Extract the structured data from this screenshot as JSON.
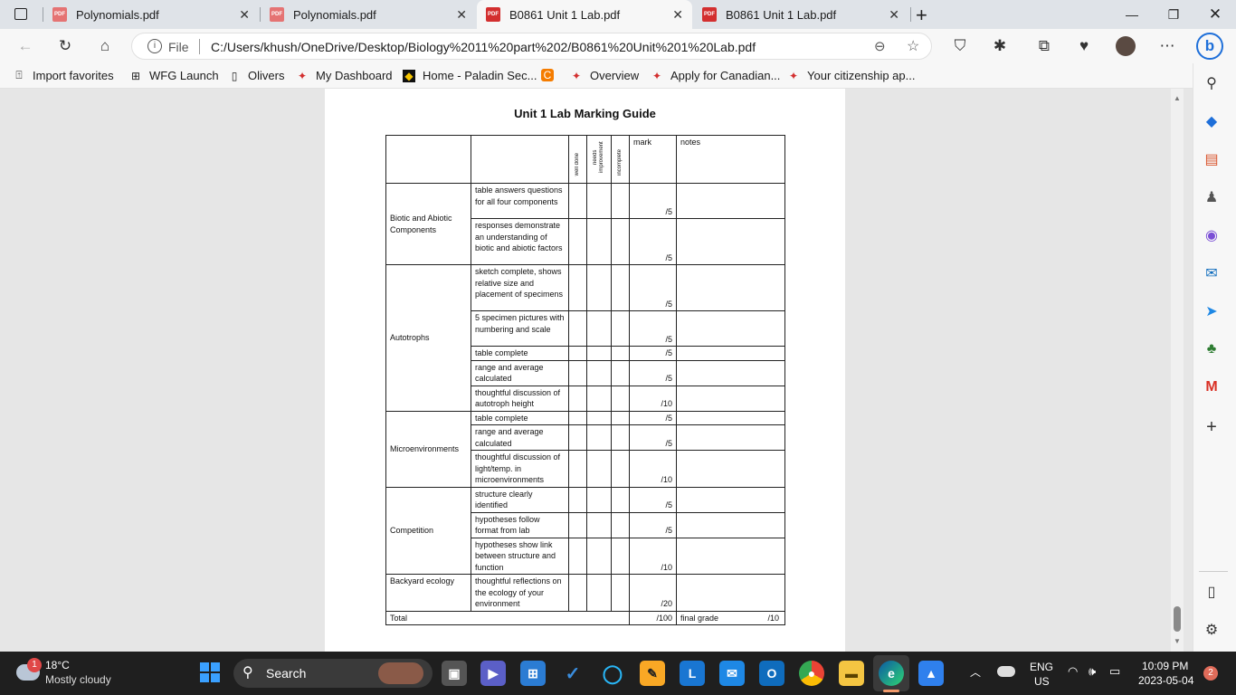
{
  "browser": {
    "tabs": [
      {
        "label": "Polynomials.pdf",
        "active": false
      },
      {
        "label": "Polynomials.pdf",
        "active": false
      },
      {
        "label": "B0861 Unit 1 Lab.pdf",
        "active": true
      },
      {
        "label": "B0861 Unit 1 Lab.pdf",
        "active": false
      }
    ],
    "file_label": "File",
    "url": "C:/Users/khush/OneDrive/Desktop/Biology%2011%20part%202/B0861%20Unit%201%20Lab.pdf",
    "favorites": [
      "Import favorites",
      "WFG Launch",
      "Olivers",
      "My Dashboard",
      "Home - Paladin Sec...",
      "Overview",
      "Apply for Canadian...",
      "Your citizenship ap..."
    ]
  },
  "document": {
    "title": "Unit 1 Lab Marking Guide",
    "header": {
      "well_done": "well done",
      "needs_improvement": "needs improvement",
      "incomplete": "incomplete",
      "mark": "mark",
      "notes": "notes"
    },
    "sections": [
      {
        "name": "Biotic and Abiotic Components",
        "rows": [
          {
            "criterion": "table answers questions for all four components",
            "mark": "/5"
          },
          {
            "criterion": "responses demonstrate an understanding of biotic and abiotic factors",
            "mark": "/5"
          }
        ]
      },
      {
        "name": "Autotrophs",
        "rows": [
          {
            "criterion": "sketch complete, shows relative size and placement of specimens",
            "mark": "/5"
          },
          {
            "criterion": "5 specimen pictures with numbering and scale",
            "mark": "/5"
          },
          {
            "criterion": "table complete",
            "mark": "/5"
          },
          {
            "criterion": "range and average calculated",
            "mark": "/5"
          },
          {
            "criterion": "thoughtful discussion of autotroph height",
            "mark": "/10"
          }
        ]
      },
      {
        "name": "Microenvironments",
        "rows": [
          {
            "criterion": "table complete",
            "mark": "/5"
          },
          {
            "criterion": "range and average calculated",
            "mark": "/5"
          },
          {
            "criterion": "thoughtful discussion of light/temp. in microenvironments",
            "mark": "/10"
          }
        ]
      },
      {
        "name": "Competition",
        "rows": [
          {
            "criterion": "structure clearly identified",
            "mark": "/5"
          },
          {
            "criterion": "hypotheses follow format from lab",
            "mark": "/5"
          },
          {
            "criterion": "hypotheses show link between structure and function",
            "mark": "/10"
          }
        ]
      },
      {
        "name": "Backyard ecology",
        "rows": [
          {
            "criterion": "thoughtful reflections on the ecology of your environment",
            "mark": "/20"
          }
        ]
      }
    ],
    "total_label": "Total",
    "total_mark": "/100",
    "final_grade_label": "final grade",
    "final_grade_mark": "/10"
  },
  "taskbar": {
    "weather_temp": "18°C",
    "weather_desc": "Mostly cloudy",
    "weather_badge": "1",
    "search_label": "Search",
    "lang_top": "ENG",
    "lang_bottom": "US",
    "time": "10:09 PM",
    "date": "2023-05-04",
    "notification_count": "2"
  }
}
